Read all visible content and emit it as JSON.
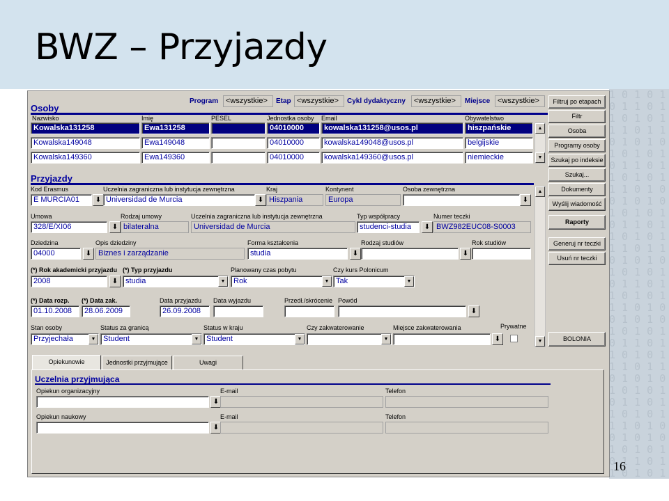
{
  "slide": {
    "title": "BWZ – Przyjazdy",
    "page_number": "16"
  },
  "top": {
    "program_label": "Program",
    "program_value": "<wszystkie>",
    "etap_label": "Etap",
    "etap_value": "<wszystkie>",
    "cykl_label": "Cykl dydaktyczny",
    "cykl_value": "<wszystkie>",
    "miejsce_label": "Miejsce",
    "miejsce_value": "<wszystkie>"
  },
  "osoby": {
    "title": "Osoby",
    "headers": [
      "Nazwisko",
      "Imię",
      "PESEL",
      "Jednostka osoby",
      "Email",
      "Obywatelstwo"
    ],
    "rows": [
      [
        "Kowalska131258",
        "Ewa131258",
        "",
        "04010000",
        "kowalska131258@usos.pl",
        "hiszpańskie"
      ],
      [
        "Kowalska149048",
        "Ewa149048",
        "",
        "04010000",
        "kowalska149048@usos.pl",
        "belgijskie"
      ],
      [
        "Kowalska149360",
        "Ewa149360",
        "",
        "04010000",
        "kowalska149360@usos.pl",
        "niemieckie"
      ]
    ]
  },
  "przyjazdy": {
    "title": "Przyjazdy",
    "kod_erasmus_label": "Kod Erasmus",
    "kod_erasmus": "E  MURCIA01",
    "uczelnia_label": "Uczelnia zagraniczna lub instytucja zewnętrzna",
    "uczelnia": "Universidad de Murcia",
    "kraj_label": "Kraj",
    "kraj": "Hiszpania",
    "kontynent_label": "Kontynent",
    "kontynent": "Europa",
    "osoba_zew_label": "Osoba zewnętrzna",
    "osoba_zew": "",
    "umowa_label": "Umowa",
    "umowa": "328/E/XI06",
    "rodzaj_umowy_label": "Rodzaj umowy",
    "rodzaj_umowy": "bilateralna",
    "uczelnia2_label": "Uczelnia zagraniczna lub instytucja zewnętrzna",
    "uczelnia2": "Universidad de Murcia",
    "typ_wsp_label": "Typ współpracy",
    "typ_wsp": "studenci-studia",
    "numer_teczki_label": "Numer teczki",
    "numer_teczki": "BWZ982EUC08-S0003",
    "dziedzina_label": "Dziedzina",
    "dziedzina": "04000",
    "opis_dz_label": "Opis dziedziny",
    "opis_dz": "Biznes i zarządzanie",
    "forma_label": "Forma kształcenia",
    "forma": "studia",
    "rodzaj_st_label": "Rodzaj studiów",
    "rodzaj_st": "",
    "rok_st_label": "Rok studiów",
    "rok_st": "",
    "rok_akad_label": "(*) Rok akademicki przyjazdu",
    "rok_akad": "2008",
    "typ_przyj_label": "(*) Typ przyjazdu",
    "typ_przyj": "studia",
    "plan_czas_label": "Planowany czas pobytu",
    "plan_czas": "Rok",
    "kurs_label": "Czy kurs Polonicum",
    "kurs": "Tak",
    "data_rozp_label": "(*) Data rozp.",
    "data_rozp": "01.10.2008",
    "data_zak_label": "(*) Data zak.",
    "data_zak": "28.06.2009",
    "data_przyj_label": "Data przyjazdu",
    "data_przyj": "26.09.2008",
    "data_wyj_label": "Data wyjazdu",
    "data_wyj": "",
    "przedl_label": "Przedł./skrócenie",
    "przedl": "",
    "powod_label": "Powód",
    "powod": "",
    "stan_label": "Stan osoby",
    "stan": "Przyjechała",
    "status_gr_label": "Status za granicą",
    "status_gr": "Student",
    "status_kr_label": "Status w kraju",
    "status_kr": "Student",
    "zakw_label": "Czy zakwaterowanie",
    "zakw": "",
    "miejsce_zakw_label": "Miejsce zakwaterowania",
    "miejsce_zakw": "",
    "prywatne_label": "Prywatne"
  },
  "buttons": {
    "filtruj": "Filtruj po etapach",
    "filtr": "Filtr",
    "osoba": "Osoba",
    "programy": "Programy osoby",
    "szukaj_indeks": "Szukaj po indeksie",
    "szukaj": "Szukaj...",
    "dokumenty": "Dokumenty",
    "wyslij": "Wyślij wiadomość",
    "raporty": "Raporty",
    "generuj": "Generuj nr teczki",
    "usun": "Usuń nr teczki",
    "bolonia": "BOLONIA"
  },
  "tabs": [
    "Opiekunowie",
    "Jednostki przyjmujące",
    "Uwagi"
  ],
  "uczelnia_przyj": {
    "title": "Uczelnia przyjmująca",
    "opiekun_org_label": "Opiekun organizacyjny",
    "opiekun_nauk_label": "Opiekun naukowy",
    "email_label": "E-mail",
    "telefon_label": "Telefon"
  },
  "colors": {
    "accent": "#00008b",
    "selection": "#00007f",
    "header_bg": "#d3e3ee"
  }
}
